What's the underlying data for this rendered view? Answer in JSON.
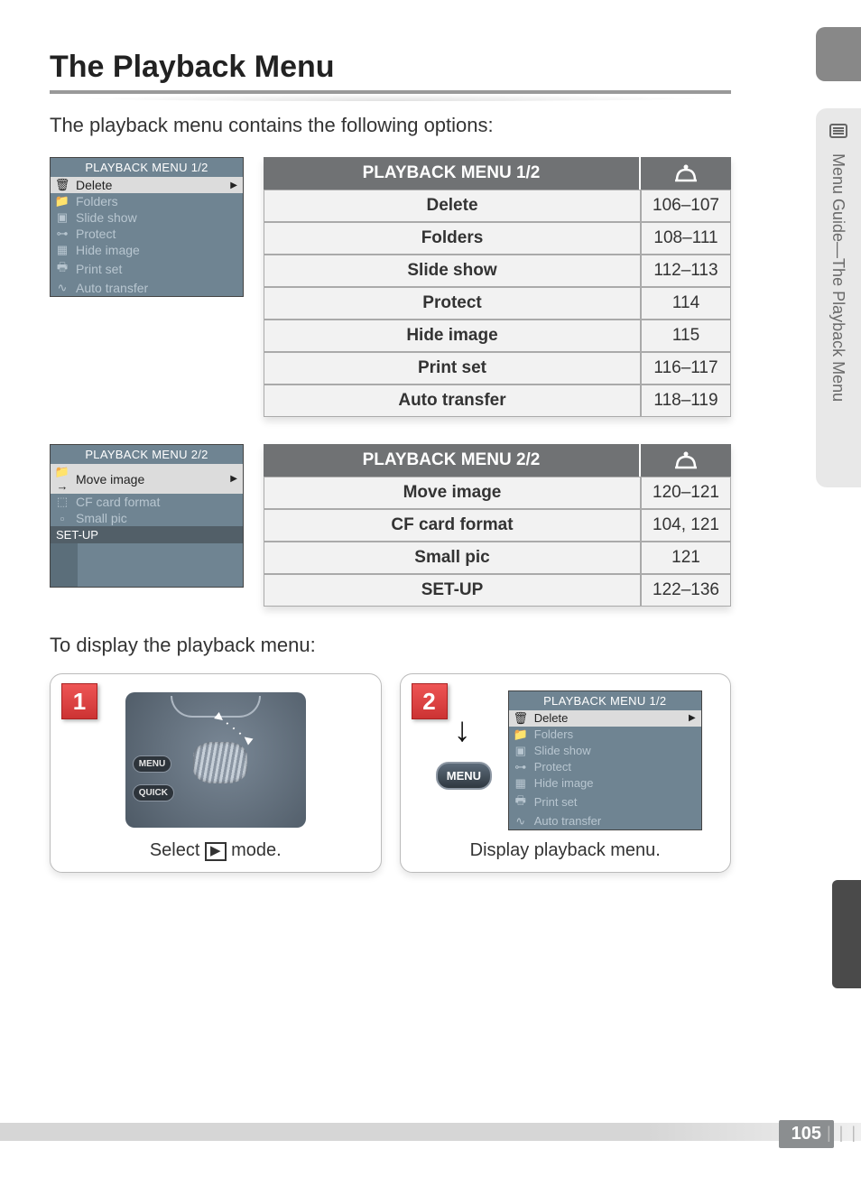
{
  "title": "The Playback Menu",
  "intro": "The playback menu contains the following options:",
  "side_label": "Menu Guide—The Playback Menu",
  "page_number": "105",
  "lcd1": {
    "title": "PLAYBACK MENU  1/2",
    "items": [
      {
        "icon": "🗑",
        "label": "Delete",
        "sel": true
      },
      {
        "icon": "📁",
        "label": "Folders"
      },
      {
        "icon": "▣",
        "label": "Slide show"
      },
      {
        "icon": "⊶",
        "label": "Protect"
      },
      {
        "icon": "▦",
        "label": "Hide image"
      },
      {
        "icon": "🖶",
        "label": "Print set"
      },
      {
        "icon": "∿",
        "label": "Auto transfer"
      }
    ]
  },
  "lcd2": {
    "title": "PLAYBACK MENU  2/2",
    "items": [
      {
        "icon": "📁→",
        "label": "Move image",
        "sel": true
      },
      {
        "icon": "⬚",
        "label": "CF card format"
      },
      {
        "icon": "▫",
        "label": "Small pic"
      }
    ],
    "setup": "SET-UP"
  },
  "table1": {
    "header": "PLAYBACK MENU 1/2",
    "rows": [
      {
        "name": "Delete",
        "page": "106–107"
      },
      {
        "name": "Folders",
        "page": "108–111"
      },
      {
        "name": "Slide show",
        "page": "112–113"
      },
      {
        "name": "Protect",
        "page": "114"
      },
      {
        "name": "Hide image",
        "page": "115"
      },
      {
        "name": "Print set",
        "page": "116–117"
      },
      {
        "name": "Auto transfer",
        "page": "118–119"
      }
    ]
  },
  "table2": {
    "header": "PLAYBACK MENU 2/2",
    "rows": [
      {
        "name": "Move image",
        "page": "120–121"
      },
      {
        "name": "CF card format",
        "page": "104, 121"
      },
      {
        "name": "Small pic",
        "page": "121"
      },
      {
        "name": "SET-UP",
        "page": "122–136"
      }
    ]
  },
  "display_intro": "To display the playback menu:",
  "steps": {
    "s1": {
      "num": "1",
      "caption_pre": "Select ",
      "caption_post": " mode.",
      "menu_label": "MENU",
      "quick_label": "QUICK"
    },
    "s2": {
      "num": "2",
      "caption": "Display playback menu.",
      "menu_label": "MENU"
    }
  }
}
